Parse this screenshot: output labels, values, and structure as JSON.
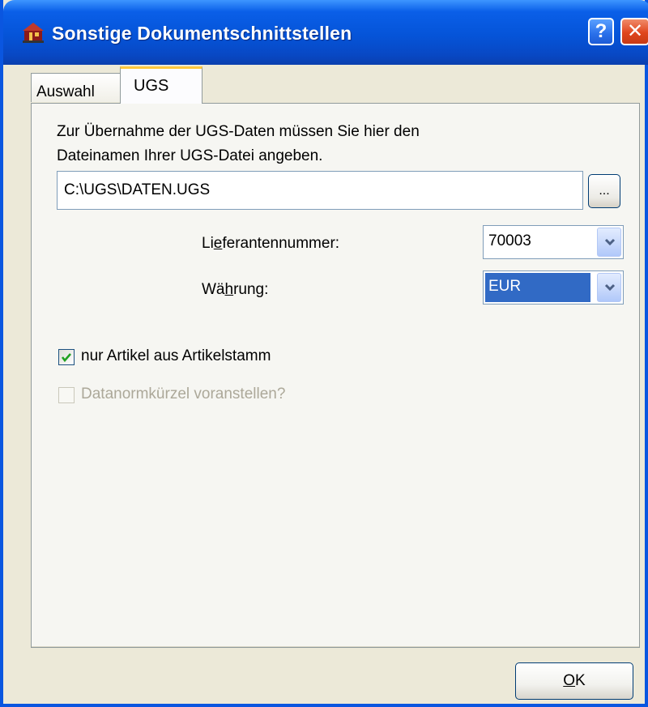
{
  "window": {
    "title": "Sonstige Dokumentschnittstellen",
    "help_label": "?",
    "close_label": "✕"
  },
  "tabs": [
    {
      "label": "Auswahl",
      "active": false
    },
    {
      "label": "UGS",
      "active": true
    }
  ],
  "ugs": {
    "description_line1": "Zur Übernahme der UGS-Daten müssen Sie hier den",
    "description_line2": "Dateinamen Ihrer UGS-Datei angeben.",
    "file_path": "C:\\UGS\\DATEN.UGS",
    "browse_label": "...",
    "lieferant": {
      "label_pre": "Li",
      "label_mnemonic": "e",
      "label_post": "ferantennummer:",
      "value": "70003"
    },
    "waehrung": {
      "label_pre": "Wä",
      "label_mnemonic": "h",
      "label_post": "rung:",
      "value": "EUR"
    },
    "checkbox_artikelstamm": {
      "label": "nur Artikel aus Artikelstamm",
      "checked": true,
      "enabled": true
    },
    "checkbox_datanorm": {
      "label": "Datanormkürzel voranstellen?",
      "checked": false,
      "enabled": false
    }
  },
  "footer": {
    "ok_mnemonic": "O",
    "ok_rest": "K"
  },
  "colors": {
    "titlebar": "#0554d8",
    "dialog_bg": "#ece9d8",
    "selection": "#316ac5",
    "tab_highlight": "#ffc83c",
    "checkmark": "#21a121"
  }
}
